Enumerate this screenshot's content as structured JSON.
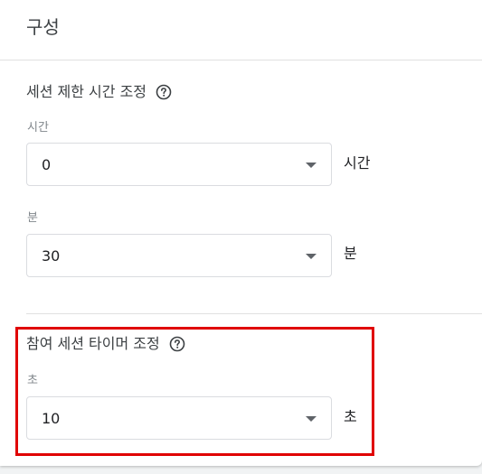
{
  "header": {
    "title": "구성"
  },
  "session_timeout": {
    "title": "세션 제한 시간 조정",
    "hours": {
      "label": "시간",
      "value": "0",
      "unit": "시간"
    },
    "minutes": {
      "label": "분",
      "value": "30",
      "unit": "분"
    }
  },
  "engaged_session": {
    "title": "참여 세션 타이머 조정",
    "seconds": {
      "label": "초",
      "value": "10",
      "unit": "초"
    }
  },
  "colors": {
    "highlight": "#e00000",
    "text": "#3c4043",
    "label": "#80868b",
    "border": "#dadce0"
  },
  "icons": {
    "help": "help-circle-icon",
    "dropdown": "caret-down-icon"
  }
}
